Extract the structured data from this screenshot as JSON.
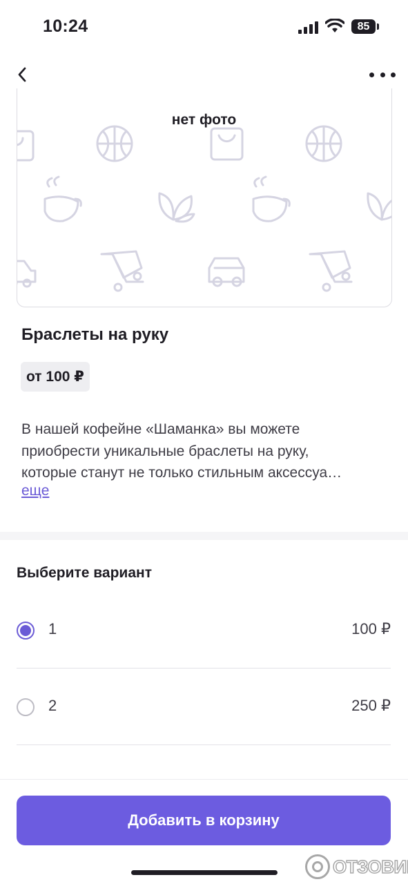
{
  "status_bar": {
    "time": "10:24",
    "battery": "85"
  },
  "nav": {
    "back_icon": "chevron-left-icon",
    "more_icon": "more-dots-icon"
  },
  "photo": {
    "placeholder_label": "нет фото",
    "pattern_icons": [
      "bag-icon",
      "basketball-icon",
      "coffee-cup-icon",
      "leaf-icon",
      "shopping-cart-icon",
      "car-icon"
    ],
    "pattern_color": "#d5d4e2"
  },
  "product": {
    "title": "Браслеты на руку",
    "price_from": "от 100 ₽",
    "description_lines": [
      "В нашей кофейне «Шаманка» вы можете",
      "приобрести уникальные браслеты на руку,",
      "которые станут не только стильным аксессуа…"
    ],
    "more_link": "еще"
  },
  "variants": {
    "title": "Выберите вариант",
    "items": [
      {
        "name": "1",
        "price": "100 ₽",
        "selected": true
      },
      {
        "name": "2",
        "price": "250 ₽",
        "selected": false
      }
    ]
  },
  "cart_button": {
    "label": "Добавить в корзину"
  },
  "watermark": {
    "text": "ОТЗОВИК"
  },
  "colors": {
    "accent": "#6c5ce0",
    "text": "#1f1d24",
    "muted": "#3e3c45"
  }
}
